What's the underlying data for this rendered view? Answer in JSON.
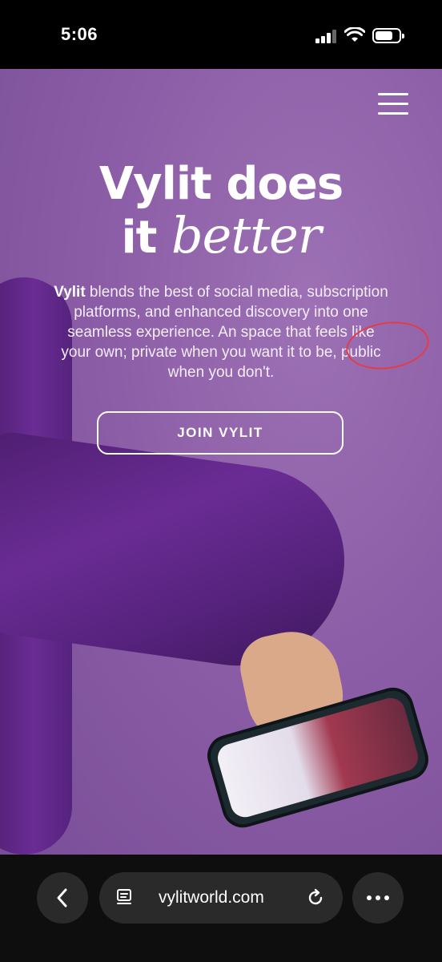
{
  "status_bar": {
    "time": "5:06",
    "battery_level": 0.75
  },
  "hero": {
    "headline_line1": "Vylit does",
    "headline_line2_plain": "it",
    "headline_line2_script": "better",
    "description_brand": "Vylit",
    "description_text": " blends the best of social media, subscription platforms, and enhanced discovery into one seamless experience. An space that feels like your own; private when you want it to be, public when you don't.",
    "join_button_label": "JOIN VYLIT",
    "annotation_color": "#e23c4a"
  },
  "browser": {
    "url": "vylitworld.com"
  },
  "icons": [
    "signal-icon",
    "wifi-icon",
    "battery-icon",
    "menu-icon",
    "back-icon",
    "page-icon",
    "reload-icon",
    "more-icon"
  ],
  "colors": {
    "hero_background": "#8c5ea7",
    "browser_bar": "#0e0e0e",
    "button_pill": "#2a2a2a"
  }
}
